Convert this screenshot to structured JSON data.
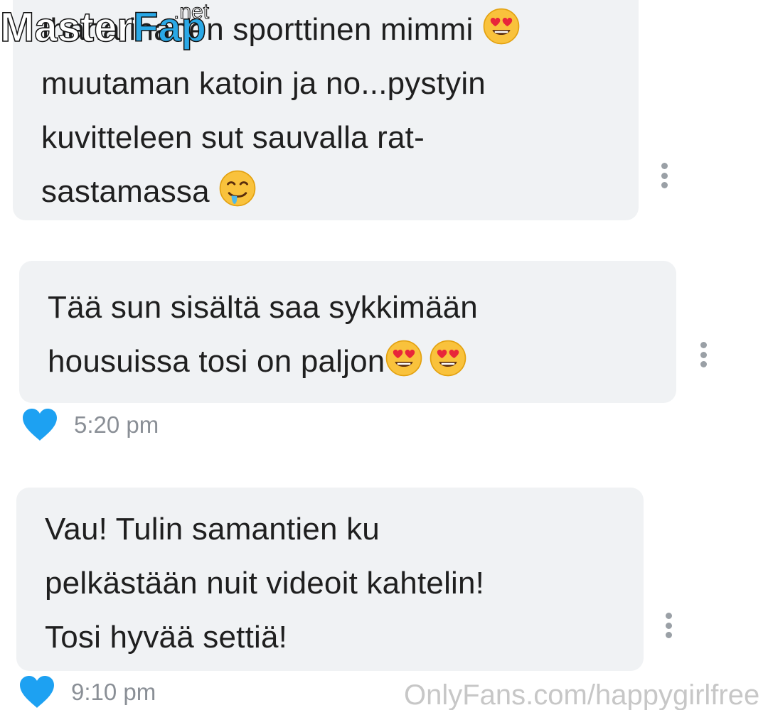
{
  "messages": [
    {
      "lines": [
        "Ihana ihanen sporttinen mimmi",
        "muutaman katoin ja no...pystyin",
        "kuvitteleen sut sauvalla rat-",
        "sastamassa"
      ],
      "emojis": [
        "heart-eyes-emoji",
        "drooling-face-emoji"
      ]
    },
    {
      "lines": [
        "Tää sun sisältä saa sykkimään",
        "housuissa tosi on paljon"
      ],
      "emojis": [
        "heart-eyes-emoji",
        "heart-eyes-emoji"
      ],
      "time": "5:20 pm",
      "liked": true
    },
    {
      "lines": [
        "Vau! Tulin samantien ku",
        "pelkästään nuit videoit kahtelin!",
        "Tosi hyvää settiä!"
      ],
      "time": "9:10 pm",
      "liked": true
    }
  ],
  "watermark": {
    "brand_left": "Master",
    "brand_right": "Fap",
    "suffix": ".net"
  },
  "footer_credit": "OnlyFans.com/happygirlfree",
  "colors": {
    "bubble": "#f0f2f4",
    "like_heart": "#1da1f2",
    "time_text": "#8a8f96",
    "menu_dots": "#9aa0a6"
  },
  "icons": {
    "message_menu": "more-vertical-icon",
    "like": "heart-icon"
  }
}
